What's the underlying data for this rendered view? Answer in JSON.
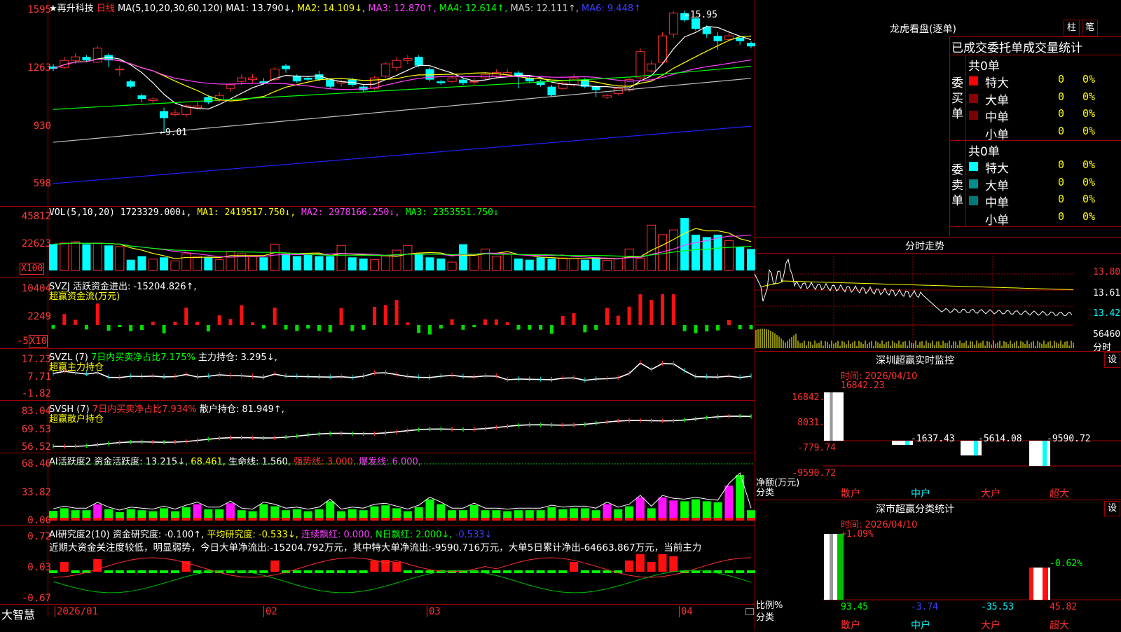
{
  "colors": {
    "up": "#ff3030",
    "down": "#00ffff",
    "grid": "#a00000",
    "ma1": "#ffffff",
    "ma2": "#ffff00",
    "ma3": "#ff40ff",
    "ma4": "#00ff00",
    "ma5": "#c0c0c0",
    "ma6": "#2020ff"
  },
  "header": {
    "star": "★",
    "stock_name": "再升科技",
    "period": "日线",
    "ma_params": "MA(5,10,20,30,60,120)",
    "ma1": "MA1: 13.790↓,",
    "ma2": "MA2: 14.109↓,",
    "ma3": "MA3: 12.870↑,",
    "ma4": "MA4: 12.614↑,",
    "ma5": "MA5: 12.111↑,",
    "ma6": "MA6: 9.448↑"
  },
  "price_axis": [
    "1595",
    "1263",
    "930",
    "598"
  ],
  "annotations": {
    "high": "15.95",
    "low": "9.01",
    "high_arrow": "←",
    "low_arrow": "←"
  },
  "vol": {
    "title": "VOL(5,10,20)",
    "value": "1723329.000↓,",
    "ma1": "MA1: 2419517.750↓,",
    "ma2": "MA2: 2978166.250↓,",
    "ma3": "MA3: 2353551.750↓",
    "axis": [
      "45812",
      "22623"
    ],
    "unit": "X100"
  },
  "svzj": {
    "title": "SVZJ  活跃资金进出: -15204.826↑,",
    "subtitle": "超赢资金流(万元)",
    "axis": [
      "10404",
      "2249",
      "-5"
    ],
    "unit": "X10"
  },
  "svzl": {
    "title": "SVZL (7)",
    "pct": "7日内买卖净占比7.175%",
    "hold": "主力持仓: 3.295↓,",
    "subtitle": "超赢主力持仓",
    "axis": [
      "17.23",
      "7.71",
      "-1.82"
    ]
  },
  "svsh": {
    "title": "SVSH (7)",
    "pct": "7日内买卖净占比7.934%",
    "hold": "散户持仓: 81.949↑,",
    "subtitle": "超赢散户持仓",
    "axis": [
      "83.04",
      "69.53",
      "56.52"
    ]
  },
  "ai1": {
    "title": "AI活跃度2 资金活跃度: 13.215↓,",
    "v2": "68.461,",
    "life": "生命线: 1.560,",
    "strong": "强势线: 3.000,",
    "burst": "爆发线: 6.000,",
    "axis": [
      "68.46",
      "33.82",
      "0.00"
    ]
  },
  "ai2": {
    "title": "AI研究度2(10) 资金研究度: -0.100↑,",
    "avg": "平均研究度: -0.533↓,",
    "lianxu": "连续飘红: 0.000,",
    "n": "N日飘红: 2.000↓,",
    "val": "-0.533↓",
    "text": "近期大资金关注度较低，明显弱势，今日大单净流出:-15204.792万元，其中特大单净流出:-9590.716万元，大单5日累计净出-64663.867万元，当前主力",
    "axis": [
      "0.72",
      "0.03",
      "-0.67"
    ]
  },
  "date_axis": {
    "brand": "大智慧",
    "d1": "2026/01",
    "d2": "02",
    "d3": "03",
    "d4": "04"
  },
  "right": {
    "lhb_title": "龙虎看盘(逐单)",
    "btn_bar": "柱",
    "btn_pen": "笔",
    "lhb_tabs": "已成交委托单成交量统计",
    "buy": {
      "label": "委买单",
      "total": "共0单",
      "rows": [
        {
          "n": "特大",
          "v": "0",
          "p": "0%"
        },
        {
          "n": "大单",
          "v": "0",
          "p": "0%"
        },
        {
          "n": "中单",
          "v": "0",
          "p": "0%"
        },
        {
          "n": "小单",
          "v": "0",
          "p": "0%"
        }
      ]
    },
    "sell": {
      "label": "委卖单",
      "total": "共0单",
      "rows": [
        {
          "n": "特大",
          "v": "0",
          "p": "0%"
        },
        {
          "n": "大单",
          "v": "0",
          "p": "0%"
        },
        {
          "n": "中单",
          "v": "0",
          "p": "0%"
        },
        {
          "n": "小单",
          "v": "0",
          "p": "0%"
        }
      ]
    },
    "fs_title": "分时走势",
    "fs_axis": [
      "13.80",
      "13.61",
      "13.42"
    ],
    "fs_vol": "56460",
    "fs_unit": "分时",
    "sz_title": "深圳超赢实时监控",
    "sz_set": "设",
    "sz_time": "时间: 2026/04/10",
    "sz_top": "16842.23",
    "sz_axis": [
      "16842.23",
      "8031.25",
      "-779.74",
      "-9590.72"
    ],
    "sz_ylabel": "净额(万元)",
    "sz_xlabel": "分类",
    "sz_vals": [
      "-1637.43",
      "-5614.08",
      "-9590.72"
    ],
    "cats": [
      "散户",
      "中户",
      "大户",
      "超大"
    ],
    "fl_title": "深市超赢分类统计",
    "fl_set": "设",
    "fl_time": "时间: 2026/04/10",
    "fl_top": "+1.09%",
    "fl_top2": "-0.62%",
    "fl_axis": [
      "75",
      "50",
      "25",
      "0"
    ],
    "fl_ylabel": "比例%",
    "fl_xlabel": "分类",
    "fl_vals": [
      "93.45",
      "-3.74",
      "-35.53",
      "45.82"
    ]
  },
  "chart_data": {
    "type": "candlestick",
    "candles": [
      {
        "o": 12.75,
        "c": 12.62,
        "h": 12.9,
        "l": 12.5
      },
      {
        "o": 12.7,
        "c": 13.1,
        "h": 13.3,
        "l": 12.6
      },
      {
        "o": 13.1,
        "c": 13.3,
        "h": 13.5,
        "l": 12.9
      },
      {
        "o": 13.3,
        "c": 13.1,
        "h": 13.4,
        "l": 13.0
      },
      {
        "o": 13.0,
        "c": 13.8,
        "h": 13.9,
        "l": 12.95
      },
      {
        "o": 13.4,
        "c": 13.1,
        "h": 13.5,
        "l": 12.7
      },
      {
        "o": 12.6,
        "c": 12.6,
        "h": 12.8,
        "l": 12.2
      },
      {
        "o": 11.9,
        "c": 11.6,
        "h": 12.0,
        "l": 11.5
      },
      {
        "o": 11.1,
        "c": 10.9,
        "h": 11.2,
        "l": 10.7
      },
      {
        "o": 10.8,
        "c": 10.9,
        "h": 11.0,
        "l": 10.6
      },
      {
        "o": 10.2,
        "c": 9.8,
        "h": 10.4,
        "l": 9.01
      },
      {
        "o": 10.0,
        "c": 10.1,
        "h": 10.3,
        "l": 9.9
      },
      {
        "o": 10.0,
        "c": 10.5,
        "h": 10.6,
        "l": 9.85
      },
      {
        "o": 10.4,
        "c": 10.5,
        "h": 10.7,
        "l": 10.3
      },
      {
        "o": 11.0,
        "c": 10.7,
        "h": 11.1,
        "l": 10.6
      },
      {
        "o": 10.8,
        "c": 11.1,
        "h": 11.3,
        "l": 10.7
      },
      {
        "o": 11.5,
        "c": 11.7,
        "h": 11.8,
        "l": 11.3
      },
      {
        "o": 11.9,
        "c": 12.1,
        "h": 12.3,
        "l": 11.7
      },
      {
        "o": 12.0,
        "c": 12.1,
        "h": 12.3,
        "l": 11.8
      },
      {
        "o": 11.9,
        "c": 11.8,
        "h": 12.1,
        "l": 11.7
      },
      {
        "o": 12.0,
        "c": 12.6,
        "h": 12.7,
        "l": 11.9
      },
      {
        "o": 12.8,
        "c": 12.6,
        "h": 12.9,
        "l": 12.4
      },
      {
        "o": 12.2,
        "c": 11.9,
        "h": 12.3,
        "l": 11.8
      },
      {
        "o": 12.1,
        "c": 12.0,
        "h": 12.2,
        "l": 11.9
      },
      {
        "o": 12.3,
        "c": 12.0,
        "h": 12.5,
        "l": 11.9
      },
      {
        "o": 12.0,
        "c": 11.6,
        "h": 12.1,
        "l": 11.5
      },
      {
        "o": 11.8,
        "c": 11.9,
        "h": 12.0,
        "l": 11.6
      },
      {
        "o": 12.0,
        "c": 11.7,
        "h": 12.1,
        "l": 11.6
      },
      {
        "o": 11.6,
        "c": 11.4,
        "h": 11.7,
        "l": 11.3
      },
      {
        "o": 11.5,
        "c": 12.1,
        "h": 12.2,
        "l": 11.4
      },
      {
        "o": 12.2,
        "c": 12.9,
        "h": 13.0,
        "l": 12.1
      },
      {
        "o": 12.7,
        "c": 13.1,
        "h": 13.3,
        "l": 12.5
      },
      {
        "o": 13.1,
        "c": 13.2,
        "h": 13.4,
        "l": 12.9
      },
      {
        "o": 13.3,
        "c": 12.8,
        "h": 13.4,
        "l": 12.7
      },
      {
        "o": 12.6,
        "c": 12.0,
        "h": 12.7,
        "l": 11.9
      },
      {
        "o": 11.9,
        "c": 11.8,
        "h": 12.0,
        "l": 11.7
      },
      {
        "o": 11.9,
        "c": 12.1,
        "h": 12.2,
        "l": 11.8
      },
      {
        "o": 12.0,
        "c": 11.8,
        "h": 12.1,
        "l": 11.7
      },
      {
        "o": 11.9,
        "c": 11.9,
        "h": 12.1,
        "l": 11.7
      },
      {
        "o": 12.1,
        "c": 12.3,
        "h": 12.4,
        "l": 12.0
      },
      {
        "o": 12.2,
        "c": 12.4,
        "h": 12.6,
        "l": 12.1
      },
      {
        "o": 12.3,
        "c": 12.4,
        "h": 12.6,
        "l": 12.2
      },
      {
        "o": 12.4,
        "c": 12.2,
        "h": 12.5,
        "l": 11.5
      },
      {
        "o": 12.1,
        "c": 11.9,
        "h": 12.2,
        "l": 11.8
      },
      {
        "o": 11.9,
        "c": 11.7,
        "h": 12.0,
        "l": 11.6
      },
      {
        "o": 11.6,
        "c": 11.1,
        "h": 11.7,
        "l": 11.0
      },
      {
        "o": 11.5,
        "c": 11.8,
        "h": 11.9,
        "l": 11.4
      },
      {
        "o": 11.7,
        "c": 12.1,
        "h": 12.3,
        "l": 11.6
      },
      {
        "o": 12.0,
        "c": 11.6,
        "h": 12.1,
        "l": 11.5
      },
      {
        "o": 11.6,
        "c": 11.4,
        "h": 11.7,
        "l": 11.0
      },
      {
        "o": 11.0,
        "c": 11.1,
        "h": 11.2,
        "l": 10.9
      },
      {
        "o": 11.2,
        "c": 11.5,
        "h": 11.6,
        "l": 11.1
      },
      {
        "o": 11.4,
        "c": 12.0,
        "h": 12.1,
        "l": 11.3
      },
      {
        "o": 12.1,
        "c": 13.6,
        "h": 13.8,
        "l": 12.0
      },
      {
        "o": 12.5,
        "c": 12.9,
        "h": 13.1,
        "l": 12.4
      },
      {
        "o": 13.0,
        "c": 14.5,
        "h": 14.7,
        "l": 12.9
      },
      {
        "o": 14.6,
        "c": 15.8,
        "h": 15.9,
        "l": 14.4
      },
      {
        "o": 15.8,
        "c": 15.4,
        "h": 15.95,
        "l": 15.3
      },
      {
        "o": 15.5,
        "c": 14.9,
        "h": 15.6,
        "l": 14.8
      },
      {
        "o": 15.0,
        "c": 14.6,
        "h": 15.1,
        "l": 14.4
      },
      {
        "o": 14.5,
        "c": 14.2,
        "h": 14.7,
        "l": 13.7
      },
      {
        "o": 14.3,
        "c": 14.5,
        "h": 14.8,
        "l": 14.2
      },
      {
        "o": 14.4,
        "c": 14.2,
        "h": 14.5,
        "l": 14.0
      },
      {
        "o": 14.1,
        "c": 13.9,
        "h": 14.2,
        "l": 13.8
      }
    ],
    "volume": [
      22000,
      23000,
      24000,
      22000,
      23000,
      21000,
      20000,
      9000,
      12000,
      9500,
      11000,
      8000,
      14000,
      12000,
      11000,
      9000,
      16000,
      14000,
      12000,
      11000,
      22000,
      14000,
      12000,
      13000,
      12000,
      12000,
      21000,
      11000,
      10000,
      9000,
      12000,
      17000,
      21000,
      14000,
      11000,
      10000,
      7000,
      22000,
      13000,
      18000,
      12000,
      14000,
      10000,
      9000,
      11000,
      10000,
      10500,
      10000,
      9000,
      11000,
      8500,
      10000,
      18000,
      10000,
      38000,
      30000,
      34000,
      44000,
      30000,
      28000,
      30000,
      25000,
      20000,
      18000
    ],
    "ma_lines": [
      "MA1",
      "MA2",
      "MA3",
      "MA4",
      "MA5",
      "MA6"
    ],
    "y_range": [
      5.98,
      15.95
    ]
  }
}
